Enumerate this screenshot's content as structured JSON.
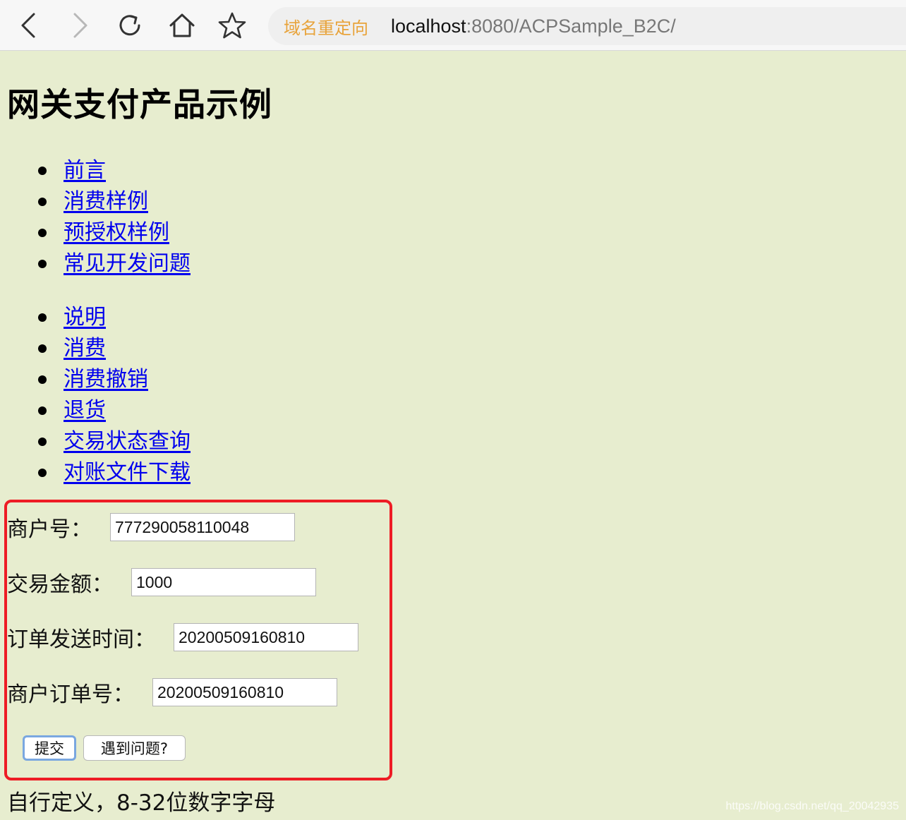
{
  "browser": {
    "redirect_label": "域名重定向",
    "url_host": "localhost",
    "url_path": ":8080/ACPSample_B2C/"
  },
  "page": {
    "title": "网关支付产品示例"
  },
  "nav_primary": [
    {
      "label": "前言"
    },
    {
      "label": "消费样例"
    },
    {
      "label": "预授权样例"
    },
    {
      "label": "常见开发问题"
    }
  ],
  "nav_secondary": [
    {
      "label": "说明"
    },
    {
      "label": "消费"
    },
    {
      "label": "消费撤销"
    },
    {
      "label": "退货"
    },
    {
      "label": "交易状态查询"
    },
    {
      "label": "对账文件下载"
    }
  ],
  "form": {
    "merchant_id": {
      "label": "商户号：",
      "value": "777290058110048"
    },
    "amount": {
      "label": "交易金额：",
      "value": "1000"
    },
    "order_time": {
      "label": "订单发送时间：",
      "value": "20200509160810"
    },
    "order_id": {
      "label": "商户订单号：",
      "value": "20200509160810"
    },
    "submit_label": "提交",
    "help_label": "遇到问题?"
  },
  "hint": "自行定义，8-32位数字字母",
  "watermark": "https://blog.csdn.net/qq_20042935"
}
